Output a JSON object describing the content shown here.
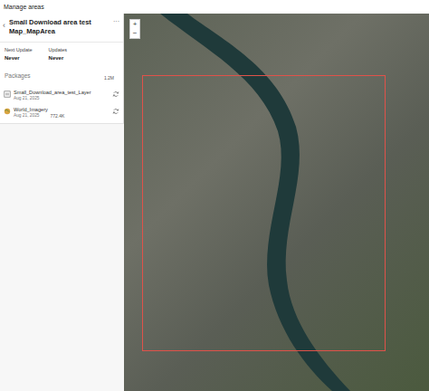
{
  "window": {
    "title": "Manage areas"
  },
  "area": {
    "back": "‹",
    "title": "Small Download area test Map_MapArea",
    "menu": "···"
  },
  "info": [
    {
      "label": "Next Update",
      "value": "Never"
    },
    {
      "label": "Updates",
      "value": "Never"
    }
  ],
  "packages": {
    "header": "Packages",
    "items": [
      {
        "name": "Small_Download_area_test_Layer",
        "date": "Aug 21, 2025",
        "size": "1.2M",
        "kind": "layer"
      },
      {
        "name": "World_Imagery",
        "date": "Aug 21, 2025",
        "size": "772.4K",
        "kind": "imagery"
      }
    ]
  },
  "map": {
    "zoom": [
      "+",
      "−"
    ]
  }
}
